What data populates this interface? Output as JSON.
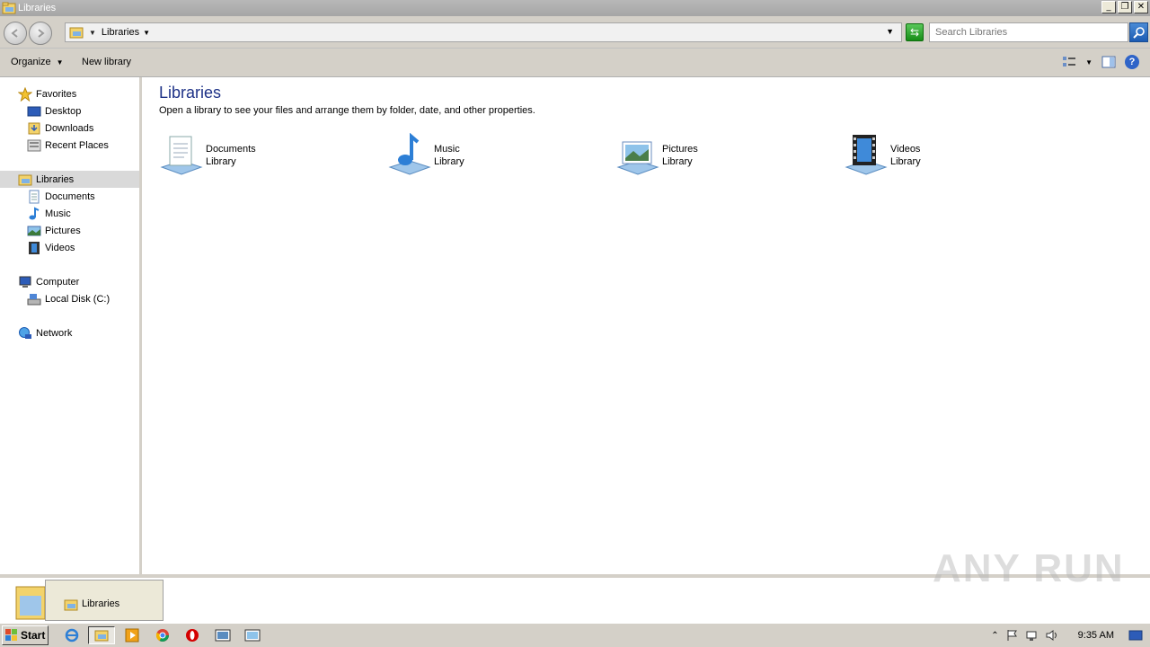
{
  "window": {
    "title": "Libraries",
    "controls": {
      "minimize": "_",
      "restore": "❐",
      "close": "✕"
    }
  },
  "address": {
    "breadcrumb": "Libraries",
    "search_placeholder": "Search Libraries"
  },
  "commands": {
    "organize": "Organize",
    "new_library": "New library"
  },
  "nav": {
    "favorites": {
      "label": "Favorites",
      "items": [
        "Desktop",
        "Downloads",
        "Recent Places"
      ]
    },
    "libraries": {
      "label": "Libraries",
      "items": [
        "Documents",
        "Music",
        "Pictures",
        "Videos"
      ]
    },
    "computer": {
      "label": "Computer",
      "items": [
        "Local Disk (C:)"
      ]
    },
    "network": {
      "label": "Network"
    }
  },
  "main": {
    "title": "Libraries",
    "subtitle": "Open a library to see your files and arrange them by folder, date, and other properties.",
    "libraries": [
      {
        "name": "Documents",
        "type": "Library",
        "icon": "documents-library-icon"
      },
      {
        "name": "Music",
        "type": "Library",
        "icon": "music-library-icon"
      },
      {
        "name": "Pictures",
        "type": "Library",
        "icon": "pictures-library-icon"
      },
      {
        "name": "Videos",
        "type": "Library",
        "icon": "videos-library-icon"
      }
    ]
  },
  "taskbar": {
    "start_label": "Start",
    "thumbnail_label": "Libraries",
    "clock": "9:35 AM",
    "watermark": "ANY RUN"
  },
  "colors": {
    "title_text": "#1e3287",
    "chrome": "#d4d0c8",
    "selection": "#d9d9d9"
  }
}
